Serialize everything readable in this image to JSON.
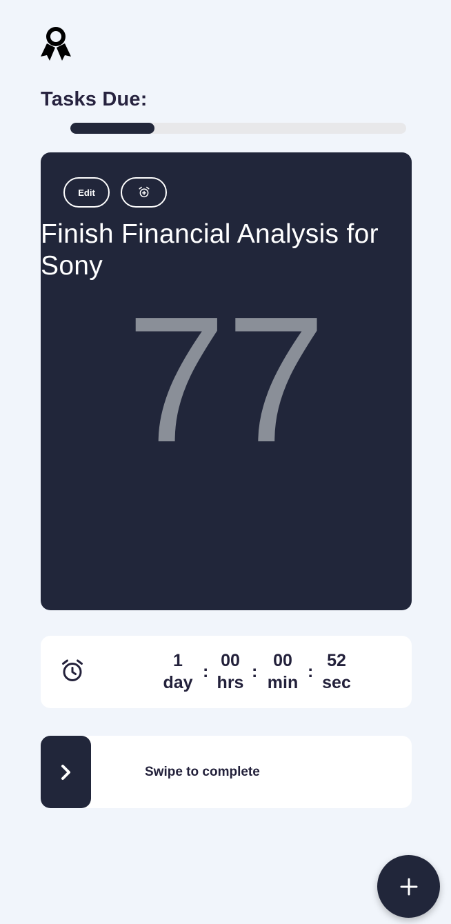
{
  "header": {
    "icon": "award-ribbon-icon",
    "title": "Tasks Due:"
  },
  "progress": {
    "fraction": 0.25
  },
  "task": {
    "edit_label": "Edit",
    "alarm_icon": "alarm-add-icon",
    "title": "Finish Financial Analysis for Sony",
    "number": "77"
  },
  "countdown": {
    "icon": "alarm-clock-icon",
    "units": [
      {
        "value": "1",
        "label": "day"
      },
      {
        "value": "00",
        "label": "hrs"
      },
      {
        "value": "00",
        "label": "min"
      },
      {
        "value": "52",
        "label": "sec"
      }
    ],
    "separator": ":"
  },
  "swipe": {
    "icon": "chevron-right-icon",
    "label": "Swipe to complete"
  },
  "fab": {
    "icon": "plus-icon"
  },
  "colors": {
    "background": "#f1f5fb",
    "card_dark": "#21263a",
    "text_dark": "#23213b",
    "number_gray": "#8a8f98"
  }
}
